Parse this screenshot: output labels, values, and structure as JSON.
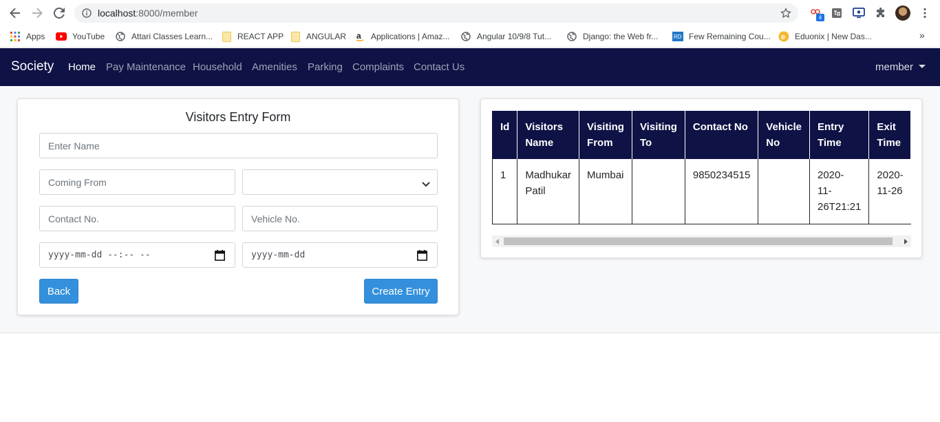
{
  "browser": {
    "url_host": "localhost",
    "url_rest": ":8000/member",
    "extension_badge": "4",
    "bookmarks": [
      {
        "label": "Apps",
        "icon": "apps-grid-icon"
      },
      {
        "label": "YouTube",
        "icon": "youtube-icon"
      },
      {
        "label": "Attari Classes Learn...",
        "icon": "globe-icon"
      },
      {
        "label": "REACT APP",
        "icon": "folder-icon"
      },
      {
        "label": "ANGULAR",
        "icon": "folder-icon"
      },
      {
        "label": "Applications | Amaz...",
        "icon": "amazon-icon"
      },
      {
        "label": "Angular 10/9/8 Tut...",
        "icon": "globe-icon"
      },
      {
        "label": "Django: the Web fr...",
        "icon": "globe-icon"
      },
      {
        "label": "Few Remaining Cou...",
        "icon": "rd-icon"
      },
      {
        "label": "Eduonix | New Das...",
        "icon": "eduonix-icon"
      }
    ]
  },
  "navbar": {
    "brand": "Society",
    "links": [
      "Home",
      "Pay Maintenance",
      "Household",
      "Amenities",
      "Parking",
      "Complaints",
      "Contact Us"
    ],
    "user_menu": "member",
    "color": "#0e1245"
  },
  "form": {
    "title": "Visitors Entry Form",
    "name_placeholder": "Enter Name",
    "coming_from_placeholder": "Coming From",
    "visiting_to_value": "",
    "contact_placeholder": "Contact No.",
    "vehicle_placeholder": "Vehicle No.",
    "entry_time_placeholder": "yyyy-mm-dd --:-- --",
    "exit_date_placeholder": "yyyy-mm-dd",
    "back_label": "Back",
    "create_label": "Create Entry",
    "button_color": "#3490dc"
  },
  "table": {
    "headers": [
      [
        "Id"
      ],
      [
        "Visitors",
        "Name"
      ],
      [
        "Visiting",
        "From"
      ],
      [
        "Visiting",
        "To"
      ],
      [
        "Contact No"
      ],
      [
        "Vehicle",
        "No"
      ],
      [
        "Entry",
        "Time"
      ],
      [
        "Exit",
        "Time"
      ]
    ],
    "rows": [
      [
        [
          "1"
        ],
        [
          "Madhukar",
          "Patil"
        ],
        [
          "Mumbai"
        ],
        [
          ""
        ],
        [
          "9850234515"
        ],
        [
          ""
        ],
        [
          "2020-",
          "11-",
          "26T21:21"
        ],
        [
          "2020-",
          "11-26"
        ]
      ]
    ]
  }
}
